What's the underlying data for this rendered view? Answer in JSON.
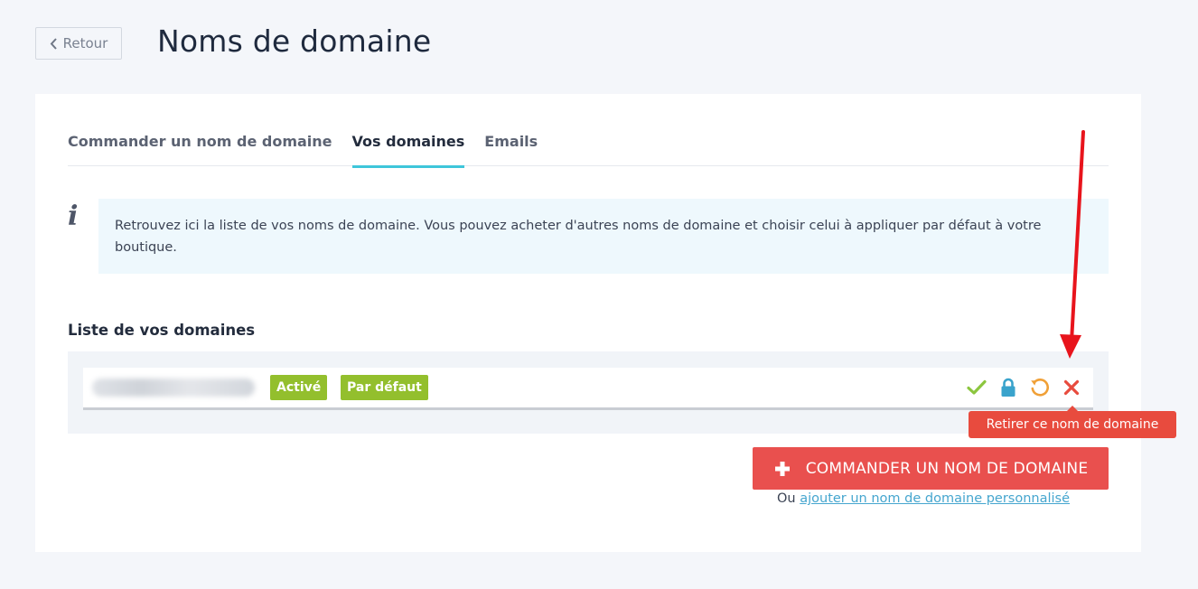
{
  "header": {
    "back_label": "Retour",
    "title": "Noms de domaine"
  },
  "tabs": [
    {
      "label": "Commander un nom de domaine",
      "active": false
    },
    {
      "label": "Vos domaines",
      "active": true
    },
    {
      "label": "Emails",
      "active": false
    }
  ],
  "info": {
    "icon": "info-icon",
    "glyph": "i",
    "text": "Retrouvez ici la liste de vos noms de domaine. Vous pouvez acheter d'autres noms de domaine et choisir celui à appliquer par défaut à votre boutique."
  },
  "domains": {
    "heading": "Liste de vos domaines",
    "rows": [
      {
        "name_blurred": true,
        "badges": [
          "Activé",
          "Par défaut"
        ],
        "actions": [
          "check-icon",
          "lock-icon",
          "refresh-icon",
          "close-icon"
        ]
      }
    ],
    "tooltip": "Retirer ce nom de domaine"
  },
  "order": {
    "button_label": "COMMANDER UN NOM DE DOMAINE",
    "button_icon": "plus-icon",
    "custom_prefix": "Ou",
    "custom_link": "ajouter un nom de domaine personnalisé"
  },
  "colors": {
    "accent": "#3ec6da",
    "badge": "#93bf2d",
    "danger": "#e9504e",
    "check": "#8cc63f",
    "lock": "#3aa3cc",
    "refresh": "#f0a037",
    "close": "#e84b3e",
    "annotation_arrow": "#e8141c"
  }
}
